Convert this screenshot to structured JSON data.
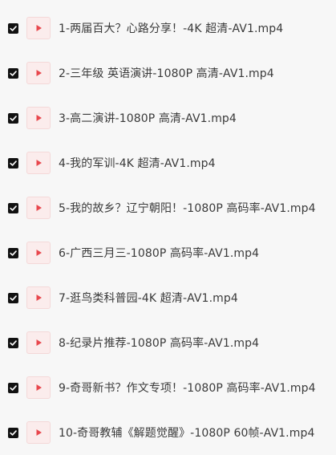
{
  "files": [
    {
      "name": "1-两届百大？心路分享！-4K 超清-AV1.mp4",
      "checked": true,
      "icon": "video-file-icon"
    },
    {
      "name": "2-三年级 英语演讲-1080P 高清-AV1.mp4",
      "checked": true,
      "icon": "video-file-icon"
    },
    {
      "name": "3-高二演讲-1080P 高清-AV1.mp4",
      "checked": true,
      "icon": "video-file-icon"
    },
    {
      "name": "4-我的军训-4K 超清-AV1.mp4",
      "checked": true,
      "icon": "video-file-icon"
    },
    {
      "name": "5-我的故乡？辽宁朝阳！-1080P 高码率-AV1.mp4",
      "checked": true,
      "icon": "video-file-icon"
    },
    {
      "name": "6-广西三月三-1080P 高码率-AV1.mp4",
      "checked": true,
      "icon": "video-file-icon"
    },
    {
      "name": "7-逛鸟类科普园-4K 超清-AV1.mp4",
      "checked": true,
      "icon": "video-file-icon"
    },
    {
      "name": "8-纪录片推荐-1080P 高码率-AV1.mp4",
      "checked": true,
      "icon": "video-file-icon"
    },
    {
      "name": "9-奇哥新书？作文专项！-1080P 高码率-AV1.mp4",
      "checked": true,
      "icon": "video-file-icon"
    },
    {
      "name": "10-奇哥教辅《解题觉醒》-1080P 60帧-AV1.mp4",
      "checked": true,
      "icon": "video-file-icon"
    }
  ],
  "colors": {
    "background": "#f7f7f7",
    "checkbox": "#111111",
    "icon_bg": "#fbecec",
    "play_accent": "#e8474d",
    "text": "#3a3a3a"
  }
}
